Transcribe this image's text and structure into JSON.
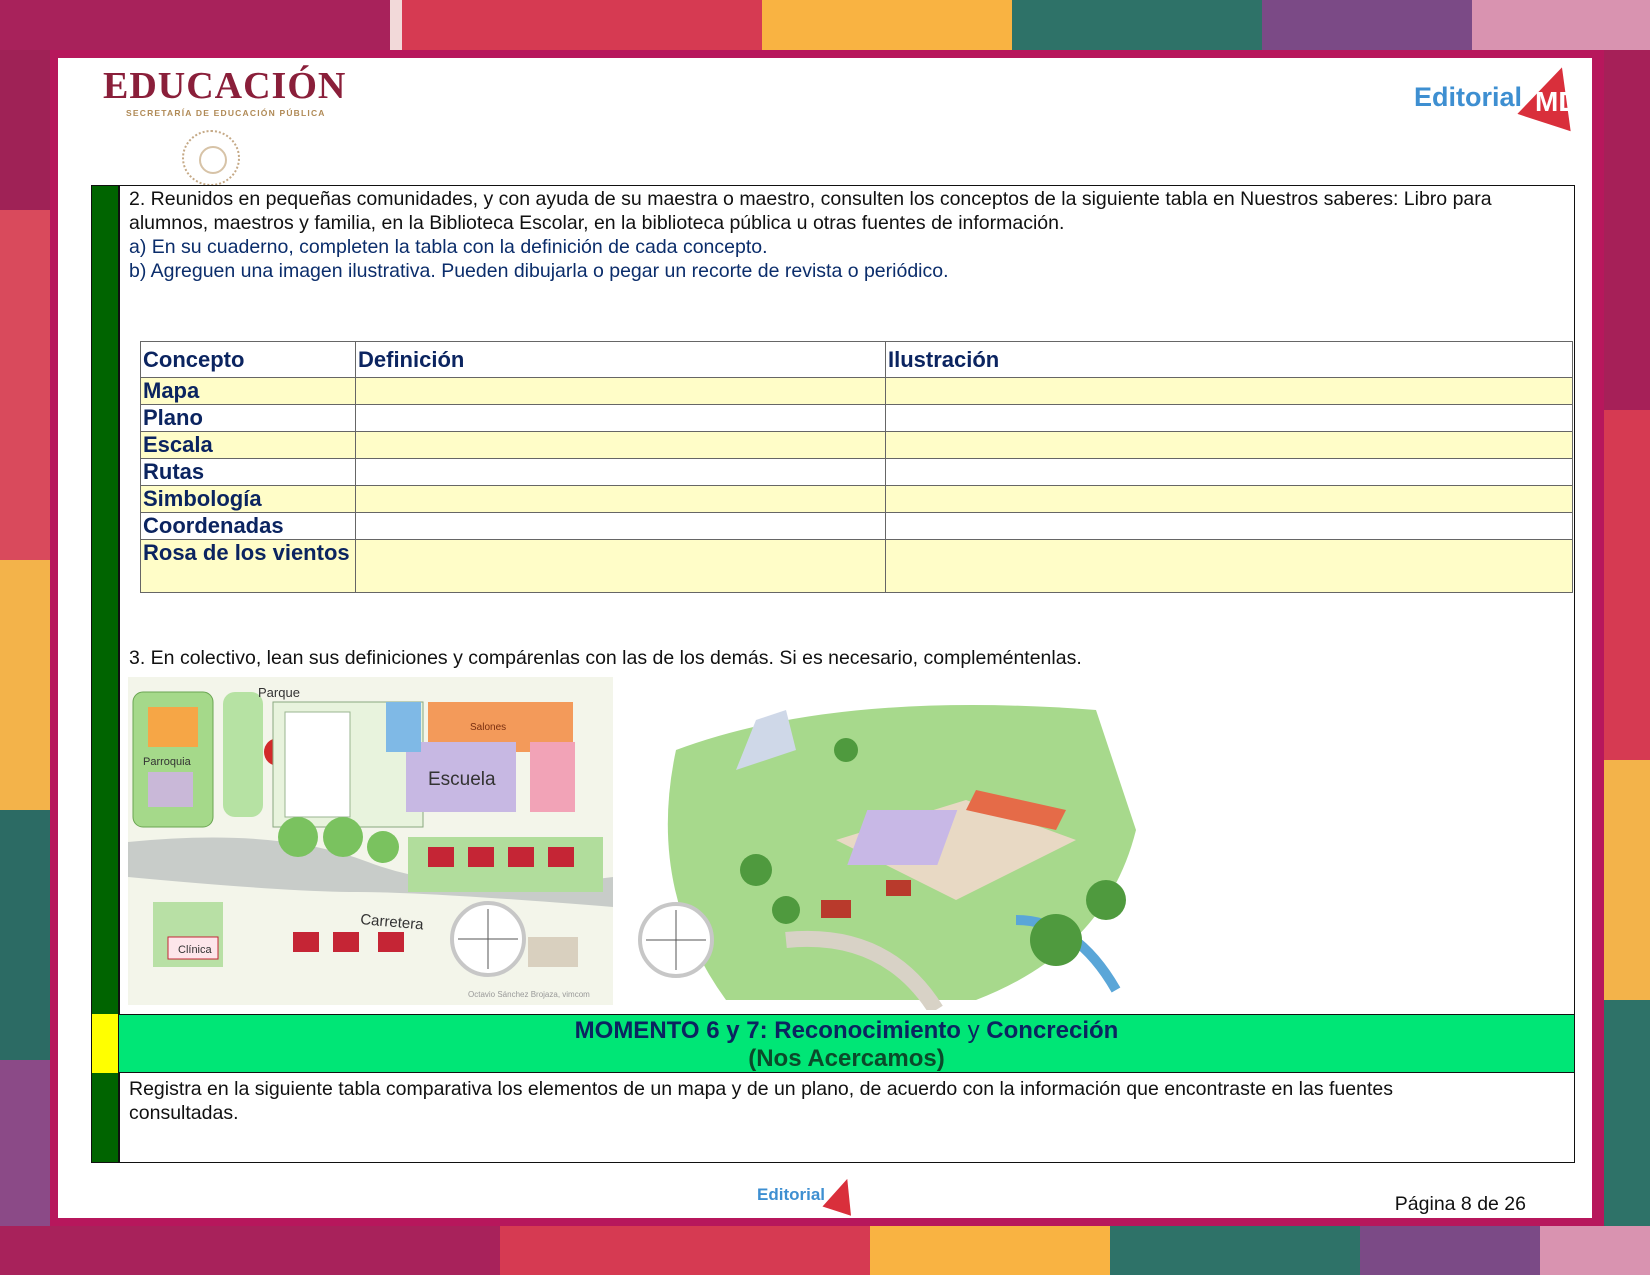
{
  "header": {
    "edu_title": "EDUCACIÓN",
    "edu_subtitle": "SECRETARÍA DE EDUCACIÓN PÚBLICA",
    "publisher": "Editorial",
    "publisher_mark": "MD"
  },
  "section2": {
    "intro": "2. Reunidos en pequeñas comunidades, y con ayuda de su maestra o maestro, consulten los conceptos de la siguiente tabla en Nuestros saberes: Libro para alumnos, maestros y familia, en la Biblioteca Escolar, en la biblioteca pública u otras fuentes de información.",
    "item_a": "a) En su cuaderno, completen la tabla con la definición de cada concepto.",
    "item_b": "b) Agreguen una imagen ilustrativa. Pueden dibujarla o pegar un recorte de revista o periódico."
  },
  "table": {
    "headers": [
      "Concepto",
      "Definición",
      "Ilustración"
    ],
    "rows": [
      "Mapa",
      "Plano",
      "Escala",
      "Rutas",
      "Simbología",
      "Coordenadas",
      "Rosa de los vientos"
    ]
  },
  "section3": {
    "text": "3. En colectivo, lean sus definiciones y compárenlas con las de los demás. Si es necesario, compleméntenlas."
  },
  "illustration": {
    "labels": {
      "parque": "Parque",
      "parroquia": "Parroquia",
      "salones": "Salones",
      "escuela": "Escuela",
      "carretera": "Carretera",
      "clinica": "Clínica",
      "credit": "Octavio Sánchez Brojaza, vimcom"
    }
  },
  "momento": {
    "line1_a": "MOMENTO 6 y 7: Reconocimiento",
    "line1_b": " y ",
    "line1_c": "Concreción",
    "line2": "(Nos Acercamos)"
  },
  "section4": {
    "text": "Registra en la siguiente tabla comparativa los elementos de un mapa y de un plano, de acuerdo con la información que encontraste en las fuentes consultadas."
  },
  "footer": {
    "publisher": "Editorial",
    "page": "Página 8 de 26"
  },
  "colors": {
    "frame": "#b7175c",
    "green_bar": "#006400",
    "momento_bg": "#00e676",
    "table_highlight": "#fffdc8"
  }
}
